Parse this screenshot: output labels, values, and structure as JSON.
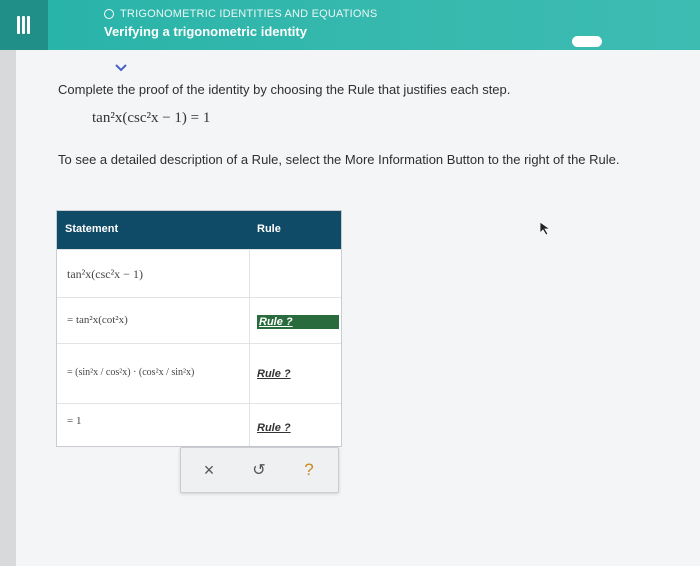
{
  "header": {
    "topic": "TRIGONOMETRIC IDENTITIES AND EQUATIONS",
    "subtitle": "Verifying a trigonometric identity"
  },
  "instructions": "Complete the proof of the identity by choosing the Rule that justifies each step.",
  "identity": "tan²x(csc²x − 1) = 1",
  "more_info_text": "To see a detailed description of a Rule, select the More Information Button to the right of the Rule.",
  "table": {
    "headers": {
      "statement": "Statement",
      "rule": "Rule"
    },
    "rows": [
      {
        "statement": "tan²x(csc²x − 1)",
        "rule": ""
      },
      {
        "statement": "= tan²x(cot²x)",
        "rule": "Rule ?"
      },
      {
        "statement": "= (sin²x / cos²x) · (cos²x / sin²x)",
        "rule": "Rule ?"
      },
      {
        "statement": "= 1",
        "rule": "Rule ?"
      }
    ]
  },
  "toolbar": {
    "clear": "×",
    "undo": "↺",
    "help": "?"
  },
  "colors": {
    "header": "#35b8ad",
    "table_header": "#0f4a67",
    "selected_rule": "#2a6b3d"
  },
  "icons": [
    "menu-icon",
    "chevron-down-icon",
    "close-icon",
    "undo-icon",
    "help-icon",
    "cursor-icon"
  ]
}
